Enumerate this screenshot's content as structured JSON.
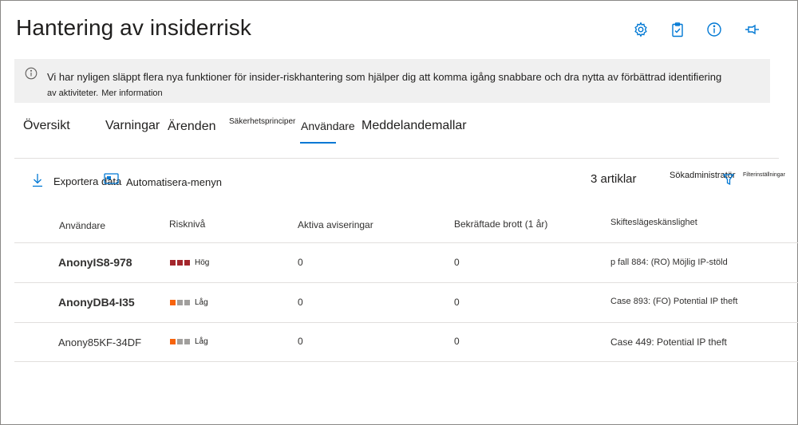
{
  "header": {
    "title": "Hantering av insiderrisk",
    "icons": [
      "gear-icon",
      "clipboard-icon",
      "info-icon",
      "pin-icon"
    ]
  },
  "banner": {
    "text_line1": "Vi har nyligen släppt flera nya funktioner för insider-riskhantering som hjälper dig att komma igång snabbare och dra nytta av förbättrad identifiering",
    "text_line2": "av aktiviteter.",
    "link": "Mer information"
  },
  "tabs": [
    {
      "label": "Översikt"
    },
    {
      "label": "Varningar"
    },
    {
      "label": "Ärenden"
    },
    {
      "label": "Säkerhetsprinciper"
    },
    {
      "label": "Användare",
      "selected": true
    },
    {
      "label": "Meddelandemallar"
    }
  ],
  "commands": {
    "export": "Exportera data",
    "automate": "Automatisera-menyn",
    "count": "3 artiklar",
    "search": "Sökadministratör",
    "filter": "Filterinställningar"
  },
  "table": {
    "headers": [
      "Användare",
      "Risknivå",
      "Aktiva aviseringar",
      "Bekräftade brott (1 år)",
      "Skifteslägeskänslighet"
    ],
    "rows": [
      {
        "user": "AnonyIS8-978",
        "risk": "Hög",
        "risk_level": 3,
        "alerts": "0",
        "breaches": "0",
        "sensitivity": "p fall 884: (RO) Möjlig IP-stöld"
      },
      {
        "user": "AnonyDB4-I35",
        "risk": "Låg",
        "risk_level": 1,
        "alerts": "0",
        "breaches": "0",
        "sensitivity": "Case 893: (FO) Potential IP theft"
      },
      {
        "user": "Anony85KF-34DF",
        "risk": "Låg",
        "risk_level": 1,
        "alerts": "0",
        "breaches": "0",
        "sensitivity": "Case 449: Potential IP theft"
      }
    ]
  },
  "colors": {
    "accent": "#0078d4",
    "high": "#a4262c",
    "low": "#f7630c",
    "inactive": "#a19f9d",
    "banner_bg": "#f0f0f0"
  }
}
